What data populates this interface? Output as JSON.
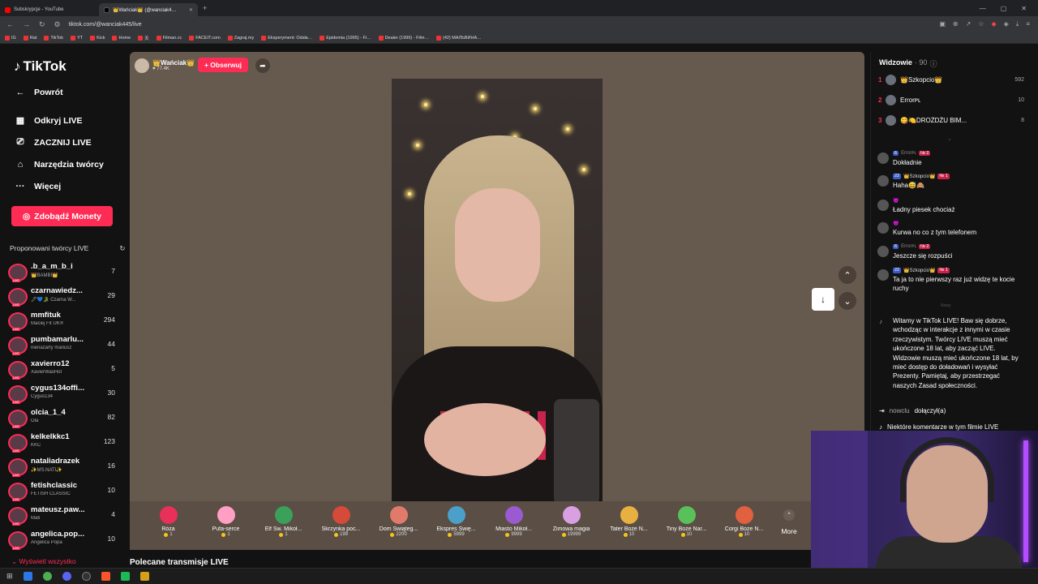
{
  "browser": {
    "tabs": [
      {
        "title": "Subskrypcje - YouTube",
        "active": false
      },
      {
        "title": "👑Wańciak👑 (@wanciak4…",
        "active": true
      }
    ],
    "url": "tiktok.com/@wanciak445/live",
    "bookmarks": [
      "IG",
      "Rat",
      "TikTok",
      "YT",
      "Kick",
      "Home",
      "天",
      "Filman.cc",
      "FACEIT.com",
      "Zagraj.my",
      "Eksperyment: Odsła…",
      "Epidemia (1995) - Fi…",
      "Dealer (1996) - Film…",
      "(42) МАЛЬВИНА…"
    ]
  },
  "sidebar": {
    "logo": "TikTok",
    "nav": [
      {
        "label": "Powrót",
        "icon": "arrow-left-icon",
        "glyph": "←"
      },
      {
        "label": "Odkryj LIVE",
        "icon": "calendar-icon",
        "glyph": "▦"
      },
      {
        "label": "ZACZNIJ LIVE",
        "icon": "video-camera-icon",
        "glyph": "⎚"
      },
      {
        "label": "Narzędzia twórcy",
        "icon": "house-icon",
        "glyph": "⌂"
      },
      {
        "label": "Więcej",
        "icon": "more-dots-icon",
        "glyph": "···"
      }
    ],
    "coins_button": "Zdobądź Monety",
    "suggested_title": "Proponowani twórcy LIVE",
    "creators": [
      {
        "name": ".b_a_m_b_i",
        "sub": "👑BAMBI👑",
        "count": "7"
      },
      {
        "name": "czarnawiedz...",
        "sub": "🖋💙🐊 Czarna W...",
        "count": "29"
      },
      {
        "name": "mmfituk",
        "sub": "Maciej Fit UK®",
        "count": "294"
      },
      {
        "name": "pumbamarlu...",
        "sub": "nienażarty mariusz",
        "count": "44"
      },
      {
        "name": "xavierro12",
        "sub": "XavierWasHot",
        "count": "5"
      },
      {
        "name": "cygus134offi...",
        "sub": "Cygus134",
        "count": "30"
      },
      {
        "name": "olcia_1_4",
        "sub": "Ola",
        "count": "82"
      },
      {
        "name": "kelkelkkc1",
        "sub": "KKC",
        "count": "123"
      },
      {
        "name": "nataliadrazek",
        "sub": "✨MS.NATI✨",
        "count": "16"
      },
      {
        "name": "fetishclassic",
        "sub": "FETISH CLASSIC",
        "count": "10"
      },
      {
        "name": "mateusz.paw...",
        "sub": "Mati",
        "count": "4"
      },
      {
        "name": "angelica.pop...",
        "sub": "Angelica Popa",
        "count": "10"
      }
    ],
    "show_all": "Wyświetl wszystko",
    "live_badge": "LIVE"
  },
  "stream": {
    "streamer_name": "👑Wańciak👑",
    "likes": "77.4K",
    "follow_button": "+ Obserwuj",
    "recommended_title": "Polecane transmisje LIVE"
  },
  "gifts": [
    {
      "name": "Róża",
      "price": "1",
      "color": "#e8305a"
    },
    {
      "name": "Pufa-serce",
      "price": "1",
      "color": "#ff9fc4"
    },
    {
      "name": "Elf Św. Mikoł...",
      "price": "1",
      "color": "#3aa05a"
    },
    {
      "name": "Skrzynka poc...",
      "price": "199",
      "color": "#d64a3a"
    },
    {
      "name": "Dom Świąteg...",
      "price": "2200",
      "color": "#e07a6a"
    },
    {
      "name": "Ekspres Świę...",
      "price": "5999",
      "color": "#4aa0c8"
    },
    {
      "name": "Miasto Mikoł...",
      "price": "9999",
      "color": "#9a5ad0"
    },
    {
      "name": "Zimowa magia",
      "price": "19999",
      "color": "#d8a0e0"
    },
    {
      "name": "Tater Boże N...",
      "price": "10",
      "color": "#e8b040"
    },
    {
      "name": "Tiny Boże Nar...",
      "price": "10",
      "color": "#5ac05a"
    },
    {
      "name": "Corgi Boże N...",
      "price": "10",
      "color": "#e06040"
    }
  ],
  "more_label": "More",
  "chat": {
    "viewers_label": "Widzowie",
    "viewers_count": "· 90",
    "ranking": [
      {
        "rank": "1",
        "name": "👑Szkopcio👑",
        "count": "592"
      },
      {
        "rank": "2",
        "name": "Errorᴘʟ",
        "count": "10"
      },
      {
        "rank": "3",
        "name": "😋🍋DROŻDŻU BIM...",
        "count": "8"
      }
    ],
    "messages": [
      {
        "meta": "Errorᴘʟ",
        "badges": [
          "6",
          "№ 2"
        ],
        "text": "Dokładnie"
      },
      {
        "meta": "👑Szkopcio👑",
        "badges": [
          "22",
          "№ 1"
        ],
        "text": "Haha😅🙈"
      },
      {
        "meta": "",
        "badges": [],
        "text": "Ładny piesek chociaż"
      },
      {
        "meta": "",
        "badges": [],
        "text": "Kurwa no co z tym telefonem"
      },
      {
        "meta": "Errorᴘʟ",
        "badges": [
          "6",
          "№ 2"
        ],
        "text": "Jeszcze się rozpuści"
      },
      {
        "meta": "👑Szkopcio👑",
        "badges": [
          "22",
          "№ 1"
        ],
        "text": "Ta ja to nie pierwszy raz już widzę te kocie ruchy"
      }
    ],
    "new_separator": "Nowy",
    "welcome": "Witamy w TikTok LIVE! Baw się dobrze, wchodząc w interakcje z innymi w czasie rzeczywistym. Twórcy LIVE muszą mieć ukończone 18 lat, aby zacząć LIVE. Widzowie muszą mieć ukończone 18 lat, by mieć dostęp do doładowań i wysyłać Prezenty. Pamiętaj, aby przestrzegać naszych Zasad społeczności.",
    "joined_user": "nowclu",
    "joined_text": "dołączył(a)",
    "comments_note": "Niektóre komentarze w tym filmie LIVE"
  }
}
